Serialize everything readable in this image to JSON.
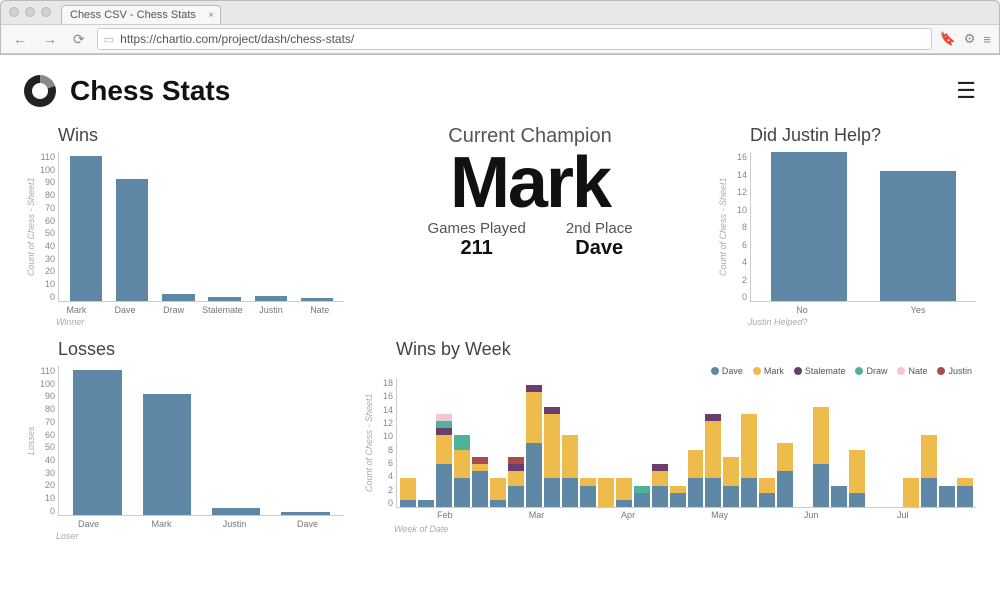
{
  "browser": {
    "tab_title": "Chess CSV - Chess Stats",
    "url": "https://chartio.com/project/dash/chess-stats/"
  },
  "header": {
    "title": "Chess Stats"
  },
  "center": {
    "champion_title": "Current Champion",
    "champion": "Mark",
    "games_played_label": "Games Played",
    "games_played": "211",
    "second_place_label": "2nd Place",
    "second_place": "Dave"
  },
  "wins_chart_title": "Wins",
  "losses_chart_title": "Losses",
  "help_chart_title": "Did Justin Help?",
  "winsbyweek_title": "Wins by Week",
  "colors": {
    "Dave": "#5f87a6",
    "Mark": "#eebb4d",
    "Stalemate": "#6b3d6f",
    "Draw": "#4fb39a",
    "Nate": "#f2c6d9",
    "Justin": "#a84c4c"
  },
  "chart_data": [
    {
      "id": "wins",
      "type": "bar",
      "title": "Wins",
      "ylabel": "Count of Chess - Sheet1",
      "xlabel": "Winner",
      "ylim": [
        0,
        110
      ],
      "categories": [
        "Mark",
        "Dave",
        "Draw",
        "Stalemate",
        "Justin",
        "Nate"
      ],
      "values": [
        107,
        90,
        5,
        3,
        4,
        2
      ]
    },
    {
      "id": "losses",
      "type": "bar",
      "title": "Losses",
      "ylabel": "Losses",
      "xlabel": "Loser",
      "ylim": [
        0,
        110
      ],
      "categories": [
        "Dave",
        "Mark",
        "Justin",
        "Dave"
      ],
      "values": [
        107,
        89,
        5,
        2
      ]
    },
    {
      "id": "justin_help",
      "type": "bar",
      "title": "Did Justin Help?",
      "ylabel": "Count of Chess - Sheet1",
      "xlabel": "Justin Helped?",
      "ylim": [
        0,
        16
      ],
      "categories": [
        "No",
        "Yes"
      ],
      "values": [
        16,
        14
      ]
    },
    {
      "id": "wins_by_week",
      "type": "bar_stacked",
      "title": "Wins by Week",
      "ylabel": "Count of Chess - Sheet1",
      "xlabel": "Week of Date",
      "ylim": [
        0,
        18
      ],
      "month_markers": [
        "Feb",
        "Mar",
        "Apr",
        "May",
        "Jun",
        "Jul"
      ],
      "series_order": [
        "Dave",
        "Mark",
        "Stalemate",
        "Draw",
        "Nate",
        "Justin"
      ],
      "weeks": [
        {
          "Dave": 1,
          "Mark": 3
        },
        {
          "Dave": 1
        },
        {
          "Dave": 6,
          "Mark": 4,
          "Draw": 1,
          "Stalemate": 1,
          "Nate": 1
        },
        {
          "Dave": 4,
          "Mark": 4,
          "Draw": 2
        },
        {
          "Dave": 5,
          "Mark": 1,
          "Justin": 1
        },
        {
          "Dave": 1,
          "Mark": 3
        },
        {
          "Dave": 3,
          "Mark": 2,
          "Stalemate": 1,
          "Justin": 1
        },
        {
          "Dave": 9,
          "Mark": 7,
          "Stalemate": 1
        },
        {
          "Dave": 4,
          "Mark": 9,
          "Stalemate": 1
        },
        {
          "Dave": 4,
          "Mark": 6
        },
        {
          "Dave": 3,
          "Mark": 1
        },
        {
          "Mark": 4
        },
        {
          "Dave": 1,
          "Mark": 3
        },
        {
          "Dave": 2,
          "Draw": 1
        },
        {
          "Dave": 3,
          "Mark": 2,
          "Stalemate": 1
        },
        {
          "Dave": 2,
          "Mark": 1
        },
        {
          "Dave": 4,
          "Mark": 4
        },
        {
          "Dave": 4,
          "Mark": 8,
          "Stalemate": 1
        },
        {
          "Dave": 3,
          "Mark": 4
        },
        {
          "Dave": 4,
          "Mark": 9
        },
        {
          "Dave": 2,
          "Mark": 2
        },
        {
          "Dave": 5,
          "Mark": 4
        },
        {},
        {
          "Dave": 6,
          "Mark": 8
        },
        {
          "Dave": 3
        },
        {
          "Dave": 2,
          "Mark": 6
        },
        {},
        {},
        {
          "Mark": 4
        },
        {
          "Dave": 4,
          "Mark": 6
        },
        {
          "Dave": 3
        },
        {
          "Dave": 3,
          "Mark": 1
        }
      ]
    }
  ]
}
